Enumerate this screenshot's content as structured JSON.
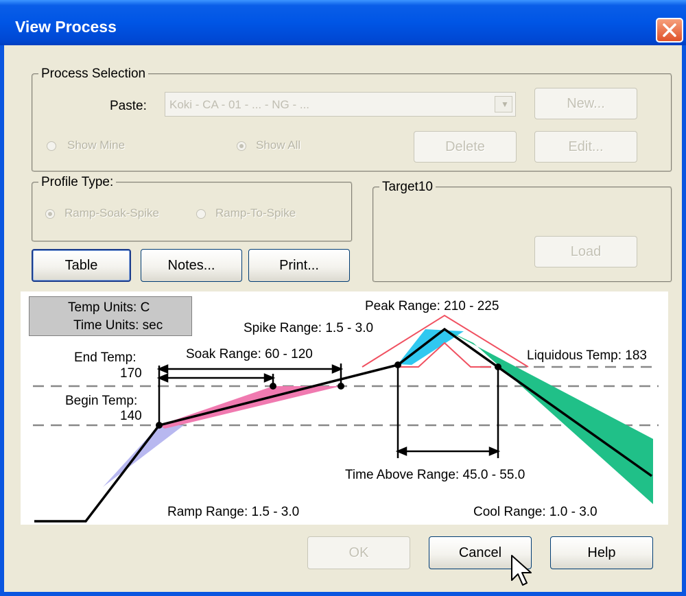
{
  "window": {
    "title": "View Process"
  },
  "process_selection": {
    "legend": "Process Selection",
    "paste_label": "Paste:",
    "paste_value": "Koki - CA - 01 - ... - NG - ...",
    "new_button": "New...",
    "show_mine": "Show Mine",
    "show_all": "Show All",
    "delete_button": "Delete",
    "edit_button": "Edit..."
  },
  "profile_type": {
    "legend": "Profile Type:",
    "option1": "Ramp-Soak-Spike",
    "option2": "Ramp-To-Spike"
  },
  "target": {
    "legend": "Target10",
    "load_button": "Load"
  },
  "buttons": {
    "table": "Table",
    "notes": "Notes...",
    "print": "Print...",
    "ok": "OK",
    "cancel": "Cancel",
    "help": "Help"
  },
  "units": {
    "temp": "Temp Units:  C",
    "time": "Time Units:  sec"
  },
  "chart": {
    "peak_range": "Peak Range: 210 - 225",
    "spike_range": "Spike Range: 1.5 - 3.0",
    "end_temp_label": "End Temp:",
    "end_temp_value": "170",
    "soak_range": "Soak Range: 60 - 120",
    "liquidous_temp": "Liquidous Temp: 183",
    "begin_temp_label": "Begin Temp:",
    "begin_temp_value": "140",
    "time_above_range": "Time Above Range: 45.0 - 55.0",
    "ramp_range": "Ramp Range: 1.5 - 3.0",
    "cool_range": "Cool Range: 1.0 - 3.0",
    "colors": {
      "ramp": "#b8b8f0",
      "soak": "#f07ab0",
      "spike": "#30c8f0",
      "cool": "#20c088",
      "peak_outline": "#f05060"
    }
  }
}
